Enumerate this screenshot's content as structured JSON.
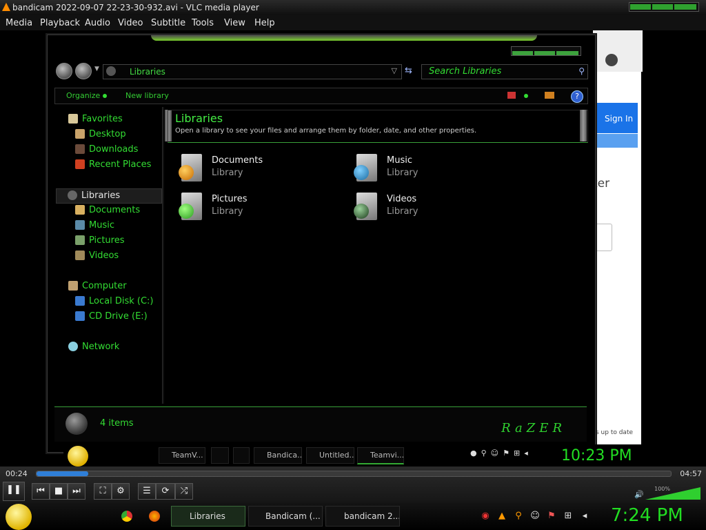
{
  "vlc": {
    "title": "bandicam 2022-09-07 22-23-30-932.avi - VLC media player",
    "menu": [
      "Media",
      "Playback",
      "Audio",
      "Video",
      "Subtitle",
      "Tools",
      "View",
      "Help"
    ],
    "time_current": "00:24",
    "time_total": "04:57",
    "progress": 0.081,
    "volume_label": "100%"
  },
  "explorer": {
    "address": "Libraries",
    "search_placeholder": "Search Libraries",
    "toolbar": {
      "organize": "Organize",
      "new_library": "New library"
    },
    "nav": {
      "favorites": "Favorites",
      "favorites_items": [
        "Desktop",
        "Downloads",
        "Recent Places"
      ],
      "libraries": "Libraries",
      "libraries_items": [
        "Documents",
        "Music",
        "Pictures",
        "Videos"
      ],
      "computer": "Computer",
      "computer_items": [
        "Local Disk (C:)",
        "CD Drive (E:)"
      ],
      "network": "Network"
    },
    "header": {
      "title": "Libraries",
      "subtitle": "Open a library to see your files and arrange them by folder, date, and other properties."
    },
    "items": [
      {
        "name": "Documents",
        "type": "Library"
      },
      {
        "name": "Music",
        "type": "Library"
      },
      {
        "name": "Pictures",
        "type": "Library"
      },
      {
        "name": "Videos",
        "type": "Library"
      }
    ],
    "item_count": "4 items",
    "brand": "RaZER"
  },
  "background_browser": {
    "signin": "Sign In",
    "partial_text": "ter",
    "status": "s up to date"
  },
  "inner_taskbar": {
    "tasks": [
      "TeamV...",
      "Bandica...",
      "Untitled...",
      "Teamvi..."
    ],
    "clock": "10:23 PM"
  },
  "taskbar": {
    "tasks": [
      "Libraries",
      "Bandicam (...",
      "bandicam 2..."
    ],
    "clock": "7:24 PM"
  },
  "colors": {
    "accent": "#33dd33",
    "vlc_progress": "#2f7fd8"
  }
}
